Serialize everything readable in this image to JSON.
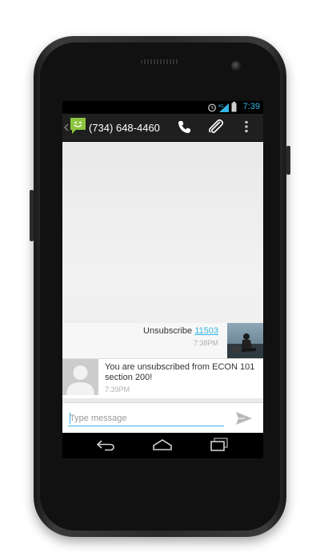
{
  "status_bar": {
    "time": "7:39"
  },
  "action_bar": {
    "contact_number": "(734) 648-4460",
    "icons": [
      "back-icon",
      "sms-app-icon",
      "phone-icon",
      "attach-icon",
      "overflow-menu-icon"
    ]
  },
  "messages": [
    {
      "direction": "outgoing",
      "text": "Unsubscribe",
      "link_text": "11503",
      "time": "7:38PM"
    },
    {
      "direction": "incoming",
      "line1": "You are unsubscribed from ECON 101",
      "line2": "section 200!",
      "time": "7:39PM"
    }
  ],
  "composer": {
    "placeholder": "Type message"
  },
  "colors": {
    "accent": "#33b5e5",
    "app_icon_green": "#8cc43f",
    "action_bar": "#1f1f1f"
  }
}
